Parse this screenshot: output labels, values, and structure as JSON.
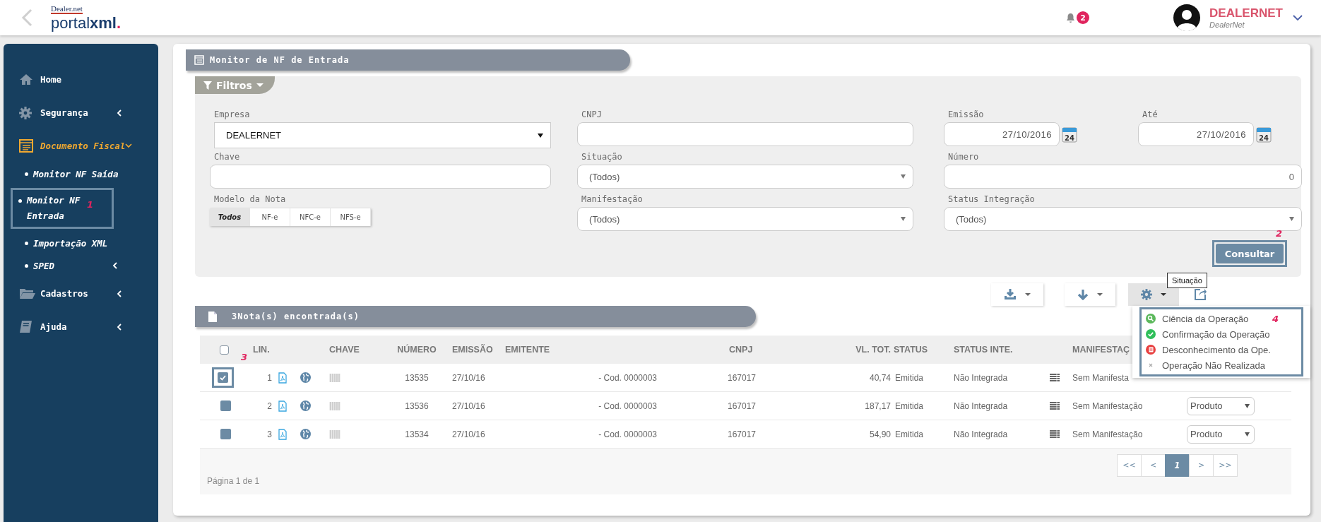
{
  "header": {
    "logo_top": "Dealer.net",
    "logo_main": "portal",
    "logo_bold": "xml",
    "logo_dot": ".",
    "notification_count": "2",
    "user_name": "DEALERNET",
    "user_company": "DealerNet"
  },
  "sidebar": {
    "items": [
      {
        "label": "Home",
        "has_submenu": false,
        "expanded": false
      },
      {
        "label": "Segurança",
        "has_submenu": true,
        "expanded": false
      },
      {
        "label": "Documento Fiscal",
        "has_submenu": true,
        "expanded": true,
        "children": [
          {
            "label": "Monitor NF Saída",
            "has_submenu": false
          },
          {
            "label": "Monitor NF Entrada",
            "has_submenu": false,
            "callout": "1"
          },
          {
            "label": "Importação XML",
            "has_submenu": false
          },
          {
            "label": "SPED",
            "has_submenu": true
          }
        ]
      },
      {
        "label": "Cadastros",
        "has_submenu": true,
        "expanded": false
      },
      {
        "label": "Ajuda",
        "has_submenu": true,
        "expanded": false
      }
    ]
  },
  "page_title": "Monitor de NF de Entrada",
  "filters": {
    "title": "Filtros",
    "rows": [
      [
        {
          "kind": "plain_select",
          "label": "Empresa",
          "value": "DEALERNET"
        },
        {
          "kind": "input",
          "label": "CNPJ"
        },
        {
          "kind": "date",
          "label": "Emissão",
          "value": "27/10/2016",
          "icon_label": "24"
        },
        {
          "kind": "date",
          "label": "Até",
          "value": "27/10/2016",
          "icon_label": "24"
        }
      ],
      [
        {
          "kind": "input",
          "label": "Chave"
        },
        {
          "kind": "select",
          "label": "Situação",
          "value": "(Todos)"
        },
        {
          "kind": "number",
          "label": "Número",
          "value": "0"
        }
      ],
      [
        {
          "kind": "toggle",
          "label": "Modelo da Nota",
          "options": [
            {
              "label": "Todos",
              "selected": true
            },
            {
              "label": "NF-e",
              "selected": false
            },
            {
              "label": "NFC-e",
              "selected": false
            },
            {
              "label": "NFS-e",
              "selected": false
            }
          ]
        },
        {
          "kind": "select",
          "label": "Manifestação",
          "value": "(Todos)"
        },
        {
          "kind": "select",
          "label": "Status Integração",
          "value": "(Todos)"
        }
      ]
    ],
    "submit": {
      "label": "Consultar",
      "callout": "2"
    }
  },
  "toolbar": {
    "buttons": [
      {
        "has_caret": true,
        "open": false
      },
      {
        "has_caret": true,
        "open": false
      },
      {
        "has_caret": true,
        "open": true
      },
      {
        "has_caret": false,
        "open": false
      }
    ],
    "tooltip": "Situação",
    "menu": {
      "callout": "4",
      "items": [
        {
          "kind": "search",
          "color": "#5cb85c",
          "label": "Ciência da Operação"
        },
        {
          "kind": "check",
          "color": "#2fbf5a",
          "label": "Confirmação da Operação"
        },
        {
          "kind": "document",
          "color": "#e84040",
          "label": "Desconhecimento da Ope."
        },
        {
          "kind": "cross",
          "color": "#aaaaaa",
          "label": "Operação Não Realizada"
        }
      ]
    }
  },
  "results": {
    "title": "3Nota(s) encontrada(s)",
    "select_all": {
      "checked": false
    },
    "columns": [
      "LIN.",
      "CHAVE",
      "NÚMERO",
      "EMISSÃO",
      "EMITENTE",
      "CNPJ",
      "VL. TOT.",
      "STATUS",
      "STATUS INTE.",
      "MANIFESTAÇ"
    ],
    "rows": [
      {
        "checked": true,
        "callout": "3",
        "line": "1",
        "number": "13535",
        "emission": "27/10/16",
        "issuer": "- Cod. 0000003",
        "cnpj": "167017",
        "total": "40,74",
        "status": "Emitida",
        "integration": "Não Integrada",
        "manifestation": "Sem Manifesta"
      },
      {
        "checked": false,
        "line": "2",
        "number": "13536",
        "emission": "27/10/16",
        "issuer": "- Cod. 0000003",
        "cnpj": "167017",
        "total": "187,17",
        "status": "Emitida",
        "integration": "Não Integrada",
        "manifestation": "Sem Manifestação",
        "type": "Produto"
      },
      {
        "checked": false,
        "line": "3",
        "number": "13534",
        "emission": "27/10/16",
        "issuer": "- Cod. 0000003",
        "cnpj": "167017",
        "total": "54,90",
        "status": "Emitida",
        "integration": "Não Integrada",
        "manifestation": "Sem Manifestação",
        "type": "Produto"
      }
    ],
    "page_info": "Página 1 de 1",
    "pagination": [
      {
        "label": "<<",
        "selected": false
      },
      {
        "label": "<",
        "selected": false
      },
      {
        "label": "1",
        "selected": true
      },
      {
        "label": ">",
        "selected": false
      },
      {
        "label": ">>",
        "selected": false
      }
    ]
  }
}
